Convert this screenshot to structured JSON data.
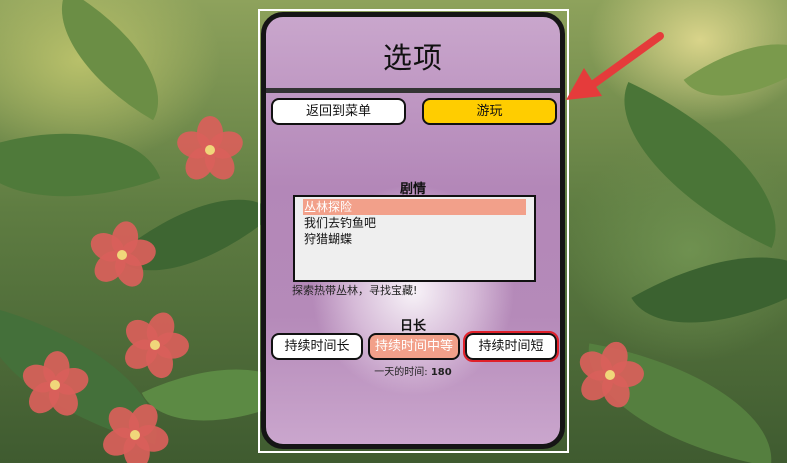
{
  "menu": {
    "title": "选项",
    "back_button": "返回到菜单",
    "play_button": "游玩"
  },
  "story": {
    "heading": "剧情",
    "options": [
      "丛林探险",
      "我们去钓鱼吧",
      "狩猎蝴蝶"
    ],
    "selected_index": 0,
    "description": "探索热带丛林，寻找宝藏!"
  },
  "day_length": {
    "heading": "日长",
    "options": [
      "持续时间长",
      "持续时间中等",
      "持续时间短"
    ],
    "selected_index": 1,
    "time_label": "一天的时间:",
    "time_value": "180"
  },
  "colors": {
    "play_button": "#ffcd00",
    "selected": "#f2a08a",
    "arrow": "#e53b3b",
    "highlight_outline": "#e0202a"
  }
}
